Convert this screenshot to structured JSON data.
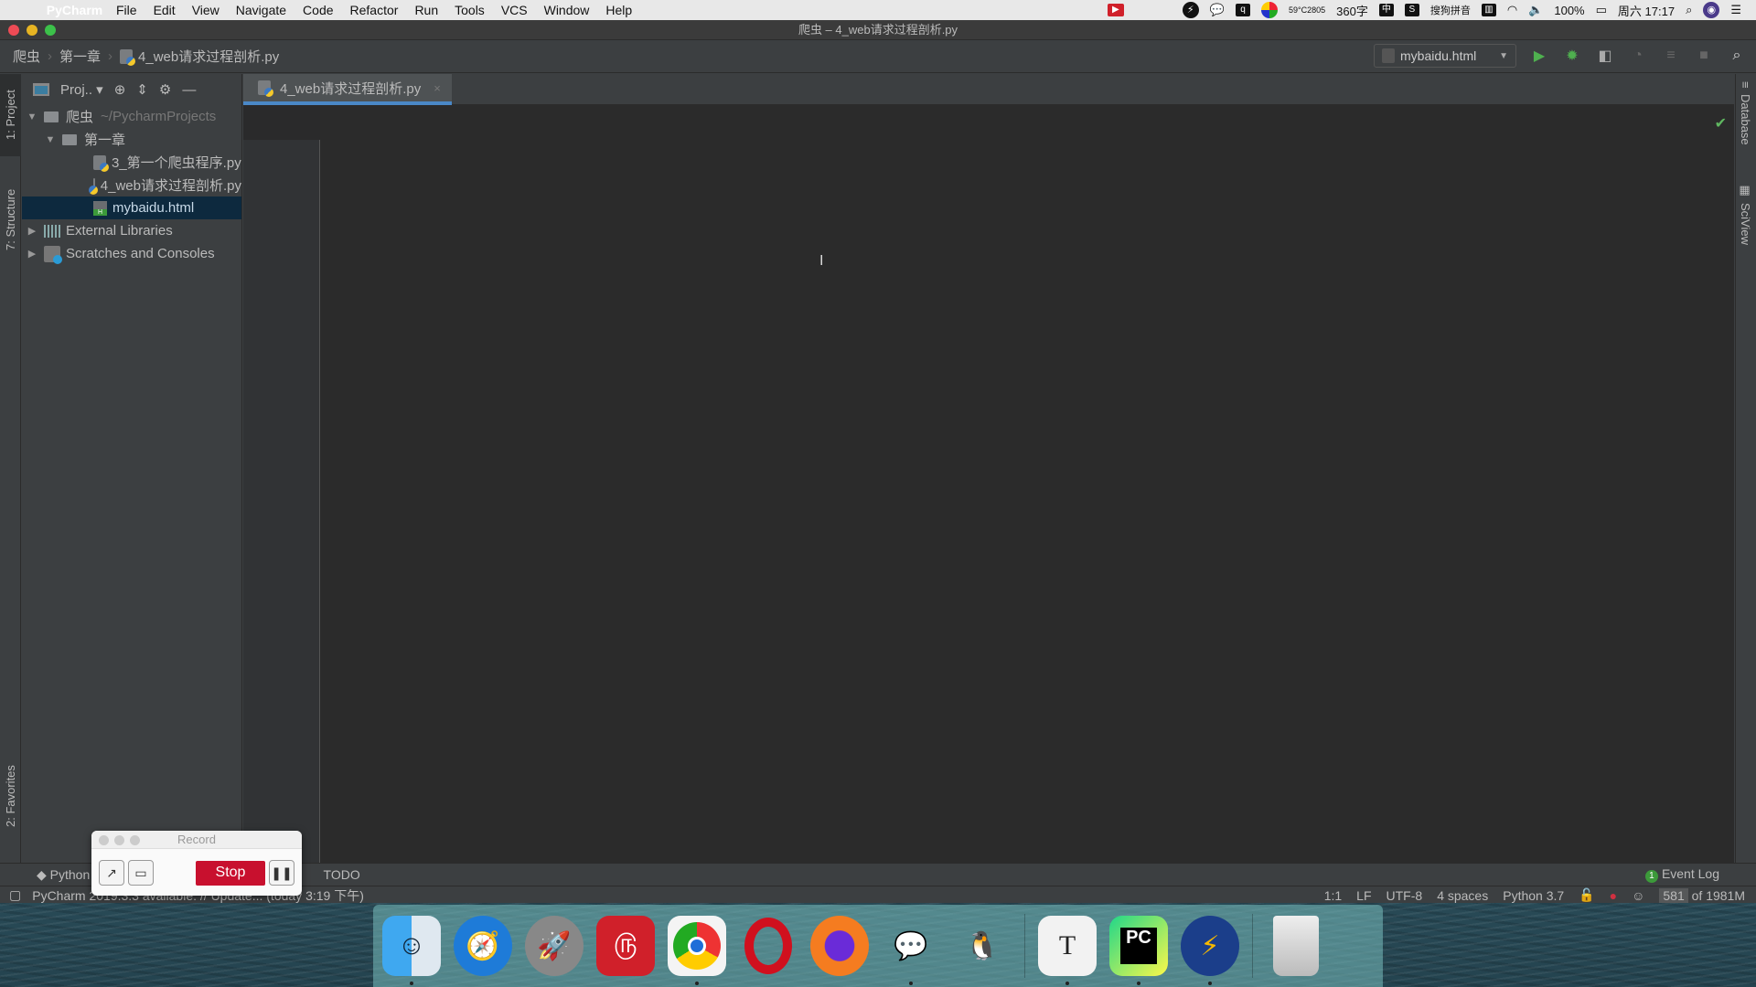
{
  "menubar": {
    "app": "PyCharm",
    "items": [
      "File",
      "Edit",
      "View",
      "Navigate",
      "Code",
      "Refactor",
      "Run",
      "Tools",
      "VCS",
      "Window",
      "Help"
    ],
    "status": {
      "temp": "59°C",
      "rpm": "2805",
      "chars": "360字",
      "ime": "中",
      "sogou": "搜狗拼音",
      "battery": "100%",
      "datetime": "周六 17:17"
    }
  },
  "window": {
    "title": "爬虫 – 4_web请求过程剖析.py"
  },
  "breadcrumb": [
    "爬虫",
    "第一章",
    "4_web请求过程剖析.py"
  ],
  "toolbar": {
    "run_config": "mybaidu.html"
  },
  "left_tabs": {
    "project": "1: Project",
    "structure": "7: Structure",
    "favorites": "2: Favorites"
  },
  "right_tabs": {
    "database": "Database",
    "sciview": "SciView"
  },
  "project": {
    "view_label": "Proj..",
    "tree": [
      {
        "label": "爬虫",
        "hint": "~/PycharmProjects"
      },
      {
        "label": "第一章"
      },
      {
        "label": "3_第一个爬虫程序.py"
      },
      {
        "label": "4_web请求过程剖析.py"
      },
      {
        "label": "mybaidu.html"
      },
      {
        "label": "External Libraries"
      },
      {
        "label": "Scratches and Consoles"
      }
    ]
  },
  "editor": {
    "tabs": [
      {
        "label": "4_web请求过程剖析.py",
        "active": true
      }
    ]
  },
  "bottom": {
    "tools": [
      "Python Console",
      "TODO"
    ],
    "event_log": "Event Log",
    "event_count": "1",
    "status_msg": "PyCharm 2019.3.3 available: // Update... (today 3:19 下午)",
    "position": "1:1",
    "line_sep": "LF",
    "encoding": "UTF-8",
    "indent": "4 spaces",
    "interpreter": "Python 3.7",
    "memory_used": "581",
    "memory_total": "of 1981M"
  },
  "record": {
    "title": "Record",
    "stop": "Stop"
  },
  "dock": [
    "Finder",
    "Safari",
    "Launchpad",
    "NetEase Music",
    "Chrome",
    "Opera",
    "Firefox",
    "WeChat",
    "QQ",
    "Typora",
    "PyCharm",
    "Thunder",
    "Trash"
  ]
}
